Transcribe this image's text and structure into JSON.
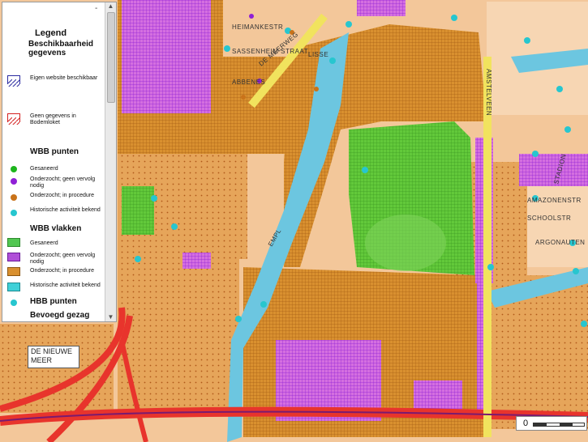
{
  "legend": {
    "collapse_symbol": "-",
    "title": "Legend",
    "section_availability": "Beschikbaarheid gegevens",
    "own_website": "Eigen website beschikbaar",
    "no_data": "Geen gegevens in Bodemloket",
    "section_wbb_points": "WBB punten",
    "wbb_points": [
      {
        "label": "Gesaneerd",
        "color": "#1db51d"
      },
      {
        "label": "Onderzocht; geen vervolg nodig",
        "color": "#8f1fd6"
      },
      {
        "label": "Onderzocht; in procedure",
        "color": "#c9731a"
      },
      {
        "label": "Historische activiteit bekend",
        "color": "#27c6cf"
      }
    ],
    "section_wbb_areas": "WBB vlakken",
    "wbb_areas": [
      {
        "label": "Gesaneerd",
        "color": "#52c752"
      },
      {
        "label": "Onderzocht; geen vervolg nodig",
        "color": "#b04fd8"
      },
      {
        "label": "Onderzocht; in procedure",
        "color": "#d9902f"
      },
      {
        "label": "Historische activiteit bekend",
        "color": "#3fd0d8"
      }
    ],
    "section_hbb_points": "HBB punten",
    "hbb_color": "#27c6cf",
    "section_authority": "Bevoegd gezag"
  },
  "map": {
    "place_label_line1": "DE NIEUWE",
    "place_label_line2": "MEER",
    "streets": {
      "heimankestraat": "HEIMANKESTR",
      "sassenheimstraat": "SASSENHEIM STRAAT",
      "meerweg": "DE MEERWEG",
      "lisse": "LISSE",
      "amstelveen": "AMSTELVEEN",
      "stadion": "STADION",
      "amazonenstraat": "AMAZONENSTR",
      "schoolstraat": "SCHOOLSTR",
      "argonautenstraat": "ARGONAUTEN",
      "emplacement": "EMPL",
      "abbenes": "ABBENES"
    },
    "colors": {
      "water": "#6cc6e0",
      "road": "#e8342c",
      "residential": "#f3c79a",
      "in_procedure": "#d9902f",
      "no_followup": "#b04fd8",
      "sanitized": "#52c752",
      "history_point": "#27c6cf"
    }
  },
  "scale": {
    "zero_label": "0"
  }
}
